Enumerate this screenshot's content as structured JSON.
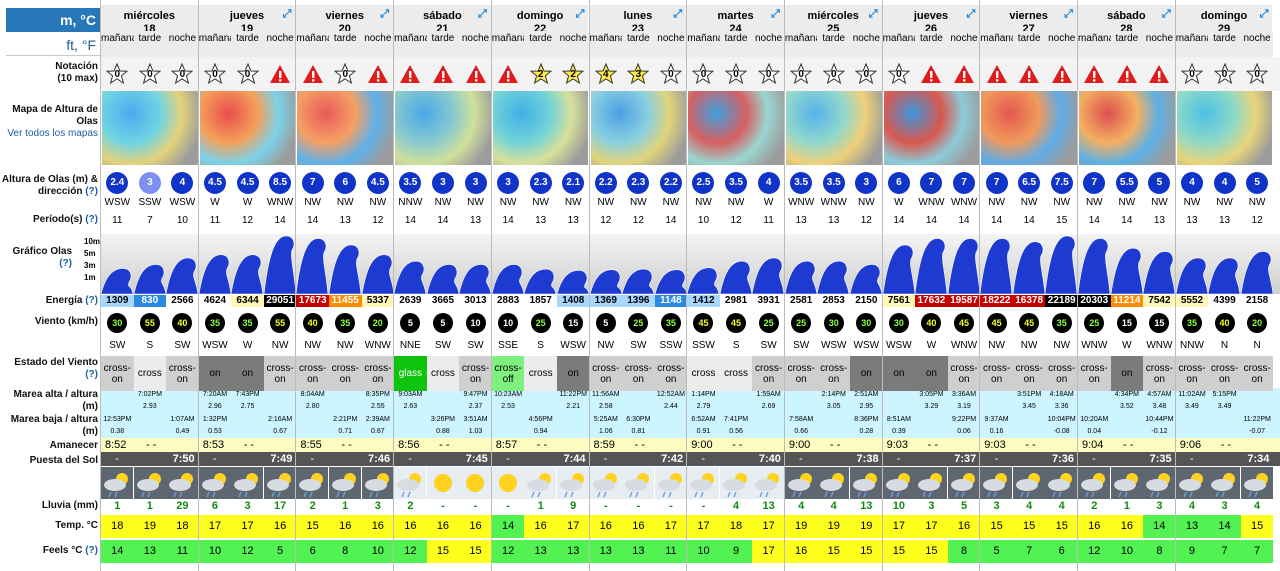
{
  "units": {
    "metric": "m, °C",
    "imperial": "ft, °F"
  },
  "labels": {
    "rating": "Notación",
    "rating_sub": "(10 max)",
    "map": "Mapa de Altura de Olas",
    "map_link": "Ver todos los mapas",
    "wave_height": "Altura de Olas (m) & dirección",
    "period": "Período(s)",
    "wave_graph": "Gráfico Olas",
    "energy": "Energía",
    "wind": "Viento (km/h)",
    "wind_state": "Estado del Viento",
    "high_tide": "Marea alta / altura (m)",
    "low_tide": "Marea baja / altura (m)",
    "sunrise": "Amanecer",
    "sunset": "Puesta del Sol",
    "rain": "Lluvia (mm)",
    "temp": "Temp. °C",
    "feels": "Feels °C",
    "help": "(?)"
  },
  "periods": [
    "mañana",
    "tarde",
    "noche"
  ],
  "graph_axis": [
    "10m",
    "5m",
    "3m",
    "1m"
  ],
  "colors": {
    "header_blue": "#2777b9",
    "yellow": "#ffff1e",
    "green": "#53f253",
    "light_cyan": "#ccf5ff"
  },
  "days": [
    {
      "name": "miércoles",
      "num": "18",
      "sunrise": "8:52",
      "sunset": "7:50",
      "rating": [
        "0",
        "0",
        "0"
      ],
      "wave": [
        "2.4",
        "3",
        "4"
      ],
      "dir": [
        "WSW",
        "SSW",
        "WSW"
      ],
      "period": [
        "11",
        "7",
        "10"
      ],
      "energy": [
        "1309",
        "830",
        "2566"
      ],
      "wind": [
        "30",
        "55",
        "40"
      ],
      "wdir": [
        "SW",
        "S",
        "SW"
      ],
      "wstate": [
        "cross-on",
        "cross",
        "cross-on"
      ],
      "rain": [
        "1",
        "1",
        "29"
      ],
      "temp": [
        "18",
        "19",
        "18"
      ],
      "feels": [
        "14",
        "13",
        "11"
      ],
      "high": [
        [
          "",
          ""
        ],
        [
          "7:02PM",
          "2.93"
        ],
        [
          "",
          ""
        ]
      ],
      "low": [
        [
          "12:53PM",
          "0.38"
        ],
        [
          "",
          ""
        ],
        [
          "1:07AM",
          "0.49"
        ]
      ]
    },
    {
      "name": "jueves",
      "num": "19",
      "sunrise": "8:53",
      "sunset": "7:49",
      "rating": [
        "0",
        "0",
        "!"
      ],
      "wave": [
        "4.5",
        "4.5",
        "8.5"
      ],
      "dir": [
        "W",
        "W",
        "WNW"
      ],
      "period": [
        "11",
        "12",
        "14"
      ],
      "energy": [
        "4624",
        "6344",
        "29051"
      ],
      "wind": [
        "35",
        "35",
        "55"
      ],
      "wdir": [
        "WSW",
        "W",
        "NW"
      ],
      "wstate": [
        "on",
        "on",
        "cross-on"
      ],
      "rain": [
        "6",
        "3",
        "17"
      ],
      "temp": [
        "17",
        "17",
        "16"
      ],
      "feels": [
        "10",
        "12",
        "5"
      ],
      "high": [
        [
          "7:20AM",
          "2.96"
        ],
        [
          "7:43PM",
          "2.75"
        ],
        [
          "",
          ""
        ]
      ],
      "low": [
        [
          "1:32PM",
          "0.53"
        ],
        [
          "",
          ""
        ],
        [
          "2:16AM",
          "0.67"
        ]
      ]
    },
    {
      "name": "viernes",
      "num": "20",
      "sunrise": "8:55",
      "sunset": "7:46",
      "rating": [
        "!",
        "0",
        "!"
      ],
      "wave": [
        "7",
        "6",
        "4.5"
      ],
      "dir": [
        "NW",
        "NW",
        "NW"
      ],
      "period": [
        "14",
        "13",
        "12"
      ],
      "energy": [
        "17673",
        "11455",
        "5337"
      ],
      "wind": [
        "40",
        "35",
        "20"
      ],
      "wdir": [
        "NW",
        "NW",
        "WNW"
      ],
      "wstate": [
        "cross-on",
        "cross-on",
        "cross-on"
      ],
      "rain": [
        "2",
        "1",
        "3"
      ],
      "temp": [
        "15",
        "16",
        "16"
      ],
      "feels": [
        "6",
        "8",
        "10"
      ],
      "high": [
        [
          "8:04AM",
          "2.80"
        ],
        [
          "",
          ""
        ],
        [
          "8:35PM",
          "2.55"
        ]
      ],
      "low": [
        [
          "",
          ""
        ],
        [
          "2:21PM",
          "0.71"
        ],
        [
          "2:39AM",
          "0.87"
        ]
      ]
    },
    {
      "name": "sábado",
      "num": "21",
      "sunrise": "8:56",
      "sunset": "7:45",
      "rating": [
        "!",
        "!",
        "!"
      ],
      "wave": [
        "3.5",
        "3",
        "3"
      ],
      "dir": [
        "NNW",
        "NW",
        "NW"
      ],
      "period": [
        "14",
        "14",
        "13"
      ],
      "energy": [
        "2639",
        "3665",
        "3013"
      ],
      "wind": [
        "5",
        "5",
        "10"
      ],
      "wdir": [
        "NNE",
        "SW",
        "SW"
      ],
      "wstate": [
        "glass",
        "cross",
        "cross-on"
      ],
      "rain": [
        "2",
        "-",
        "-"
      ],
      "temp": [
        "16",
        "16",
        "16"
      ],
      "feels": [
        "12",
        "15",
        "15"
      ],
      "high": [
        [
          "9:03AM",
          "2.63"
        ],
        [
          "",
          ""
        ],
        [
          "9:47PM",
          "2.37"
        ]
      ],
      "low": [
        [
          "",
          ""
        ],
        [
          "3:26PM",
          "0.88"
        ],
        [
          "3:51AM",
          "1.03"
        ]
      ]
    },
    {
      "name": "domingo",
      "num": "22",
      "sunrise": "8:57",
      "sunset": "7:44",
      "rating": [
        "!",
        "2",
        "2"
      ],
      "wave": [
        "3",
        "2.3",
        "2.1"
      ],
      "dir": [
        "NW",
        "NW",
        "NW"
      ],
      "period": [
        "14",
        "13",
        "13"
      ],
      "energy": [
        "2883",
        "1857",
        "1408"
      ],
      "wind": [
        "10",
        "25",
        "15"
      ],
      "wdir": [
        "SSE",
        "S",
        "WSW"
      ],
      "wstate": [
        "cross-off",
        "cross",
        "on"
      ],
      "rain": [
        "-",
        "1",
        "9"
      ],
      "temp": [
        "14",
        "16",
        "17"
      ],
      "feels": [
        "12",
        "13",
        "13"
      ],
      "high": [
        [
          "10:23AM",
          "2.53"
        ],
        [
          "",
          ""
        ],
        [
          "11:22PM",
          "2.21"
        ]
      ],
      "low": [
        [
          "",
          ""
        ],
        [
          "4:56PM",
          "0.94"
        ],
        [
          "",
          ""
        ]
      ]
    },
    {
      "name": "lunes",
      "num": "23",
      "sunrise": "8:59",
      "sunset": "7:42",
      "rating": [
        "4",
        "3",
        "0"
      ],
      "wave": [
        "2.2",
        "2.3",
        "2.2"
      ],
      "dir": [
        "NW",
        "NW",
        "NW"
      ],
      "period": [
        "12",
        "12",
        "14"
      ],
      "energy": [
        "1369",
        "1396",
        "1148"
      ],
      "wind": [
        "5",
        "25",
        "35"
      ],
      "wdir": [
        "NW",
        "SW",
        "SSW"
      ],
      "wstate": [
        "cross-on",
        "cross-on",
        "cross-on"
      ],
      "rain": [
        "-",
        "-",
        "-"
      ],
      "temp": [
        "16",
        "16",
        "17"
      ],
      "feels": [
        "13",
        "13",
        "11"
      ],
      "high": [
        [
          "11:56AM",
          "2.58"
        ],
        [
          "",
          ""
        ],
        [
          "12:52AM",
          "2.44"
        ]
      ],
      "low": [
        [
          "5:25AM",
          "1.06"
        ],
        [
          "6:30PM",
          "0.81"
        ],
        [
          "",
          ""
        ]
      ]
    },
    {
      "name": "martes",
      "num": "24",
      "sunrise": "9:00",
      "sunset": "7:40",
      "rating": [
        "0",
        "0",
        "0"
      ],
      "wave": [
        "2.5",
        "3.5",
        "4"
      ],
      "dir": [
        "NW",
        "NW",
        "W"
      ],
      "period": [
        "10",
        "12",
        "11"
      ],
      "energy": [
        "1412",
        "2981",
        "3931"
      ],
      "wind": [
        "45",
        "45",
        "25"
      ],
      "wdir": [
        "SSW",
        "S",
        "SW"
      ],
      "wstate": [
        "cross",
        "cross",
        "cross-on"
      ],
      "rain": [
        "-",
        "4",
        "13"
      ],
      "temp": [
        "17",
        "18",
        "17"
      ],
      "feels": [
        "10",
        "9",
        "17"
      ],
      "high": [
        [
          "1:14PM",
          "2.79"
        ],
        [
          "",
          ""
        ],
        [
          "1:59AM",
          "2.69"
        ]
      ],
      "low": [
        [
          "6:52AM",
          "0.91"
        ],
        [
          "7:41PM",
          "0.56"
        ],
        [
          "",
          ""
        ]
      ]
    },
    {
      "name": "miércoles",
      "num": "25",
      "sunrise": "9:00",
      "sunset": "7:38",
      "rating": [
        "0",
        "0",
        "0"
      ],
      "wave": [
        "3.5",
        "3.5",
        "3"
      ],
      "dir": [
        "WNW",
        "WNW",
        "NW"
      ],
      "period": [
        "13",
        "13",
        "12"
      ],
      "energy": [
        "2581",
        "2853",
        "2150"
      ],
      "wind": [
        "25",
        "30",
        "30"
      ],
      "wdir": [
        "SW",
        "WSW",
        "WSW"
      ],
      "wstate": [
        "cross-on",
        "cross-on",
        "on"
      ],
      "rain": [
        "4",
        "4",
        "13"
      ],
      "temp": [
        "19",
        "19",
        "19"
      ],
      "feels": [
        "16",
        "15",
        "15"
      ],
      "high": [
        [
          "",
          ""
        ],
        [
          "2:14PM",
          "3.05"
        ],
        [
          "2:51AM",
          "2.95"
        ]
      ],
      "low": [
        [
          "7:58AM",
          "0.66"
        ],
        [
          "",
          ""
        ],
        [
          "8:36PM",
          "0.28"
        ]
      ]
    },
    {
      "name": "jueves",
      "num": "26",
      "sunrise": "9:03",
      "sunset": "7:37",
      "rating": [
        "0",
        "!",
        "!"
      ],
      "wave": [
        "6",
        "7",
        "7"
      ],
      "dir": [
        "W",
        "WNW",
        "WNW"
      ],
      "period": [
        "14",
        "14",
        "14"
      ],
      "energy": [
        "7561",
        "17632",
        "19587"
      ],
      "wind": [
        "30",
        "40",
        "45"
      ],
      "wdir": [
        "WSW",
        "W",
        "WNW"
      ],
      "wstate": [
        "on",
        "on",
        "cross-on"
      ],
      "rain": [
        "10",
        "3",
        "5"
      ],
      "temp": [
        "17",
        "17",
        "16"
      ],
      "feels": [
        "15",
        "15",
        "8"
      ],
      "high": [
        [
          "",
          ""
        ],
        [
          "3:05PM",
          "3.29"
        ],
        [
          "3:36AM",
          "3.19"
        ]
      ],
      "low": [
        [
          "8:51AM",
          "0.39"
        ],
        [
          "",
          ""
        ],
        [
          "9:22PM",
          "0.06"
        ]
      ]
    },
    {
      "name": "viernes",
      "num": "27",
      "sunrise": "9:03",
      "sunset": "7:36",
      "rating": [
        "!",
        "!",
        "!"
      ],
      "wave": [
        "7",
        "6.5",
        "7.5"
      ],
      "dir": [
        "NW",
        "NW",
        "NW"
      ],
      "period": [
        "14",
        "14",
        "15"
      ],
      "energy": [
        "18222",
        "16378",
        "22189"
      ],
      "wind": [
        "45",
        "45",
        "35"
      ],
      "wdir": [
        "NW",
        "NW",
        "NW"
      ],
      "wstate": [
        "cross-on",
        "cross-on",
        "cross-on"
      ],
      "rain": [
        "3",
        "4",
        "4"
      ],
      "temp": [
        "15",
        "15",
        "15"
      ],
      "feels": [
        "5",
        "7",
        "6"
      ],
      "high": [
        [
          "",
          ""
        ],
        [
          "3:51PM",
          "3.45"
        ],
        [
          "4:18AM",
          "3.36"
        ]
      ],
      "low": [
        [
          "9:37AM",
          "0.16"
        ],
        [
          "",
          ""
        ],
        [
          "10:04PM",
          "-0.08"
        ]
      ]
    },
    {
      "name": "sábado",
      "num": "28",
      "sunrise": "9:04",
      "sunset": "7:35",
      "rating": [
        "!",
        "!",
        "!"
      ],
      "wave": [
        "7",
        "5.5",
        "5"
      ],
      "dir": [
        "NW",
        "NW",
        "NW"
      ],
      "period": [
        "14",
        "14",
        "13"
      ],
      "energy": [
        "20303",
        "11214",
        "7542"
      ],
      "wind": [
        "25",
        "15",
        "15"
      ],
      "wdir": [
        "WNW",
        "W",
        "WNW"
      ],
      "wstate": [
        "cross-on",
        "on",
        "cross-on"
      ],
      "rain": [
        "2",
        "1",
        "3"
      ],
      "temp": [
        "16",
        "16",
        "14"
      ],
      "feels": [
        "12",
        "10",
        "8"
      ],
      "high": [
        [
          "",
          ""
        ],
        [
          "4:34PM",
          "3.52"
        ],
        [
          "4:57AM",
          "3.48"
        ]
      ],
      "low": [
        [
          "10:20AM",
          "0.04"
        ],
        [
          "",
          ""
        ],
        [
          "10:44PM",
          "-0.12"
        ]
      ]
    },
    {
      "name": "domingo",
      "num": "29",
      "sunrise": "9:06",
      "sunset": "7:34",
      "rating": [
        "0",
        "0",
        "0"
      ],
      "wave": [
        "4",
        "4",
        "5"
      ],
      "dir": [
        "NW",
        "NW",
        "NW"
      ],
      "period": [
        "13",
        "13",
        "12"
      ],
      "energy": [
        "5552",
        "4399",
        "2158"
      ],
      "wind": [
        "35",
        "40",
        "20"
      ],
      "wdir": [
        "NNW",
        "N",
        "N"
      ],
      "wstate": [
        "cross-on",
        "cross-on",
        "cross-on"
      ],
      "rain": [
        "4",
        "3",
        "4"
      ],
      "temp": [
        "13",
        "14",
        "15"
      ],
      "feels": [
        "9",
        "7",
        "7"
      ],
      "high": [
        [
          "11:02AM",
          "3.49"
        ],
        [
          "5:15PM",
          "3.49"
        ],
        [
          "",
          ""
        ]
      ],
      "low": [
        [
          "",
          ""
        ],
        [
          "",
          ""
        ],
        [
          "11:22PM",
          "-0.07"
        ]
      ]
    }
  ]
}
